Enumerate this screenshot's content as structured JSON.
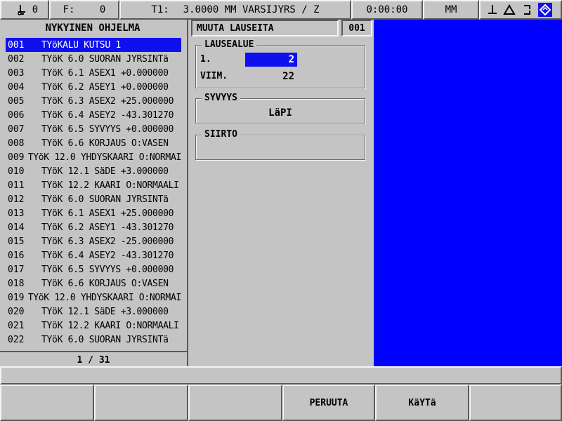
{
  "status": {
    "tool_label": "0",
    "feed_label": "F:",
    "feed_value": "0",
    "tool_info": "T1:",
    "tool_spec": "3.0000 MM VARSIJYRS / Z",
    "time": "0:00:00",
    "units": "MM"
  },
  "program": {
    "title": "NYKYINEN OHJELMA",
    "rows": [
      {
        "no": "001",
        "text": "TYöKALU KUTSU  1"
      },
      {
        "no": "002",
        "text": "TYöK 6.0 SUORAN JYRSINTä"
      },
      {
        "no": "003",
        "text": "TYöK 6.1 ASEX1 +0.000000"
      },
      {
        "no": "004",
        "text": "TYöK 6.2 ASEY1 +0.000000"
      },
      {
        "no": "005",
        "text": "TYöK 6.3 ASEX2 +25.000000"
      },
      {
        "no": "006",
        "text": "TYöK 6.4 ASEY2 -43.301270"
      },
      {
        "no": "007",
        "text": "TYöK 6.5 SYVYYS +0.000000"
      },
      {
        "no": "008",
        "text": "TYöK 6.6 KORJAUS O:VASEN"
      },
      {
        "no": "009",
        "text": "TYöK 12.0 YHDYSKAARI O:NORMAI"
      },
      {
        "no": "010",
        "text": "TYöK 12.1 SäDE +3.000000"
      },
      {
        "no": "011",
        "text": "TYöK 12.2 KAARI O:NORMAALI"
      },
      {
        "no": "012",
        "text": "TYöK 6.0 SUORAN JYRSINTä"
      },
      {
        "no": "013",
        "text": "TYöK 6.1 ASEX1 +25.000000"
      },
      {
        "no": "014",
        "text": "TYöK 6.2 ASEY1 -43.301270"
      },
      {
        "no": "015",
        "text": "TYöK 6.3 ASEX2 -25.000000"
      },
      {
        "no": "016",
        "text": "TYöK 6.4 ASEY2 -43.301270"
      },
      {
        "no": "017",
        "text": "TYöK 6.5 SYVYYS +0.000000"
      },
      {
        "no": "018",
        "text": "TYöK 6.6 KORJAUS O:VASEN"
      },
      {
        "no": "019",
        "text": "TYöK 12.0 YHDYSKAARI O:NORMAI"
      },
      {
        "no": "020",
        "text": "TYöK 12.1 SäDE +3.000000"
      },
      {
        "no": "021",
        "text": "TYöK 12.2 KAARI O:NORMAALI"
      },
      {
        "no": "022",
        "text": "TYöK 6.0 SUORAN JYRSINTä"
      }
    ],
    "page": "1 / 31"
  },
  "edit": {
    "title": "MUUTA LAUSEITA",
    "block_no": "001",
    "range_label": "LAUSEALUE",
    "first_label": "1.",
    "first_value": "2",
    "last_label": "VIIM.",
    "last_value": "22",
    "depth_label": "SYVYYS",
    "depth_value": "LäPI",
    "offset_label": "SIIRTO"
  },
  "softkeys": [
    "",
    "",
    "",
    "PERUUTA",
    "KäYTä",
    ""
  ],
  "colors": {
    "selection": "#1010ee",
    "graphic_area": "#0000ff"
  }
}
